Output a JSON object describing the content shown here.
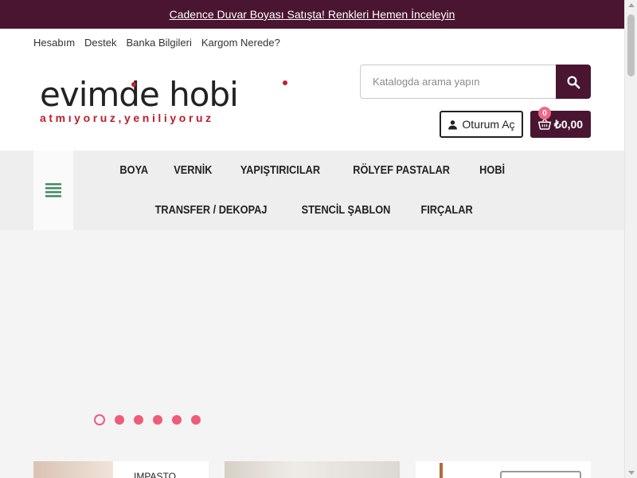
{
  "announcement": {
    "text": "Cadence Duvar Boyası Satışta! Renkleri Hemen İnceleyin"
  },
  "userlinks": [
    "Hesabım",
    "Destek",
    "Banka Bilgileri",
    "Kargom Nerede?"
  ],
  "logo": {
    "word": "evimde hobi",
    "tagline": "atmıyoruz,yeniliyoruz"
  },
  "search": {
    "placeholder": "Katalogda arama yapın",
    "icon": "search-icon"
  },
  "account": {
    "label": "Oturum Aç",
    "icon": "user-icon"
  },
  "cart": {
    "count": "0",
    "total": "₺0,00",
    "icon": "basket-icon"
  },
  "nav": {
    "row1": [
      "BOYA",
      "VERNİK",
      "YAPIŞTIRICILAR",
      "RÖLYEF PASTALAR",
      "HOBİ"
    ],
    "row2": [
      "TRANSFER / DEKOPAJ",
      "STENCİL ŞABLON",
      "FIRÇALAR"
    ]
  },
  "slider": {
    "dot_count": 6,
    "active_index": 0
  },
  "cards": [
    {
      "title": "IMPASTO"
    }
  ],
  "colors": {
    "brand": "#4a1530",
    "accent": "#ee5c7a",
    "logo_red": "#b8202d",
    "menu_icon": "#3f8a5a"
  }
}
